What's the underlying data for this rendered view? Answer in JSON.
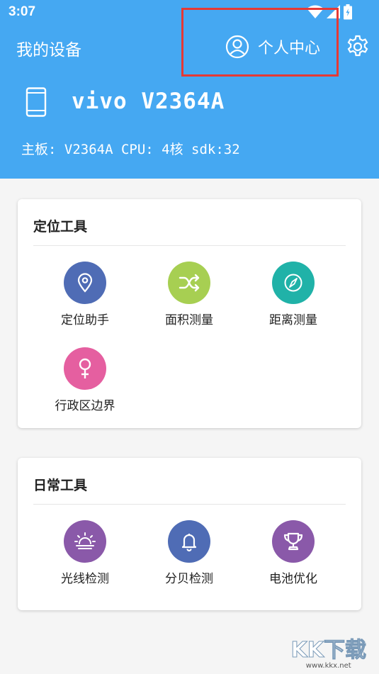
{
  "status_bar": {
    "time": "3:07"
  },
  "header": {
    "app_title": "我的设备",
    "profile_label": "个人中心",
    "device_name": "vivo V2364A",
    "device_specs": "主板: V2364A CPU: 4核 sdk:32"
  },
  "sections": [
    {
      "title": "定位工具",
      "tools": [
        {
          "label": "定位助手",
          "icon": "location-pin-icon",
          "color": "#4f6cb5"
        },
        {
          "label": "面积测量",
          "icon": "shuffle-icon",
          "color": "#a7cf52"
        },
        {
          "label": "距离测量",
          "icon": "compass-icon",
          "color": "#20b2a8"
        },
        {
          "label": "行政区边界",
          "icon": "female-symbol-icon",
          "color": "#e55fa0"
        }
      ]
    },
    {
      "title": "日常工具",
      "tools": [
        {
          "label": "光线检测",
          "icon": "sunset-icon",
          "color": "#8a59a9"
        },
        {
          "label": "分贝检测",
          "icon": "bell-icon",
          "color": "#4f6cb5"
        },
        {
          "label": "电池优化",
          "icon": "trophy-icon",
          "color": "#8a59a9"
        }
      ]
    }
  ],
  "watermark": {
    "brand": "KK下载",
    "url": "www.kkx.net"
  }
}
